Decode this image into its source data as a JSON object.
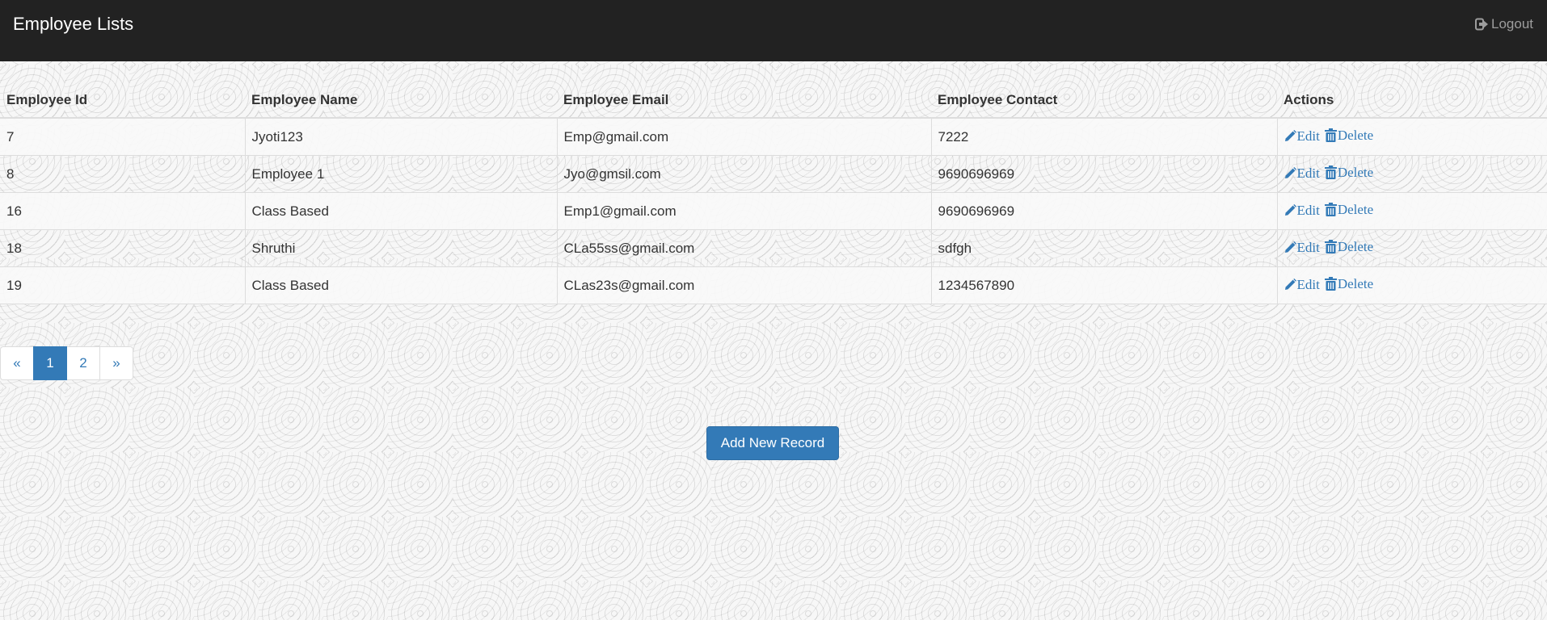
{
  "header": {
    "brand": "Employee Lists",
    "logout_label": "Logout"
  },
  "table": {
    "columns": [
      "Employee Id",
      "Employee Name",
      "Employee Email",
      "Employee Contact",
      "Actions"
    ],
    "rows": [
      {
        "id": "7",
        "name": "Jyoti123",
        "email": "Emp@gmail.com",
        "contact": "7222"
      },
      {
        "id": "8",
        "name": "Employee 1",
        "email": "Jyo@gmsil.com",
        "contact": "9690696969"
      },
      {
        "id": "16",
        "name": "Class Based",
        "email": "Emp1@gmail.com",
        "contact": "9690696969"
      },
      {
        "id": "18",
        "name": "Shruthi",
        "email": "CLa55ss@gmail.com",
        "contact": "sdfgh"
      },
      {
        "id": "19",
        "name": "Class Based",
        "email": "CLas23s@gmail.com",
        "contact": "1234567890"
      }
    ],
    "edit_label": "Edit",
    "delete_label": "Delete"
  },
  "pagination": {
    "prev": "«",
    "pages": [
      "1",
      "2"
    ],
    "current": "1",
    "next": "»"
  },
  "add_button_label": "Add New Record",
  "icons": {
    "logout": "logout-icon",
    "edit": "pencil-icon",
    "delete": "trash-icon"
  },
  "colors": {
    "navbar": "#222222",
    "accent": "#337ab7",
    "logout_text": "#9d9d9d"
  }
}
